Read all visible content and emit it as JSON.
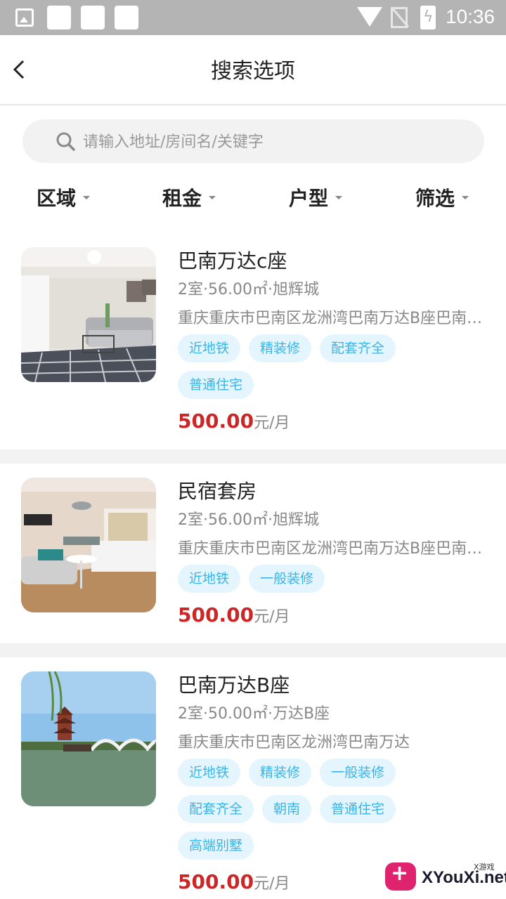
{
  "status_bar": {
    "time": "10:36"
  },
  "header": {
    "title": "搜索选项",
    "back_icon": "chevron-left-icon"
  },
  "search": {
    "placeholder": "请输入地址/房间名/关键字",
    "value": ""
  },
  "filters": [
    {
      "label": "区域"
    },
    {
      "label": "租金"
    },
    {
      "label": "户型"
    },
    {
      "label": "筛选"
    }
  ],
  "listings": [
    {
      "title": "巴南万达c座",
      "spec": "2室·56.00㎡·旭辉城",
      "address": "重庆重庆市巴南区龙洲湾巴南万达B座巴南万达",
      "tags": [
        "近地铁",
        "精装修",
        "配套齐全",
        "普通住宅"
      ],
      "price": "500.00",
      "unit": "元/月",
      "image": "living-room-photo"
    },
    {
      "title": "民宿套房",
      "spec": "2室·56.00㎡·旭辉城",
      "address": "重庆重庆市巴南区龙洲湾巴南万达B座巴南万达",
      "tags": [
        "近地铁",
        "一般装修"
      ],
      "price": "500.00",
      "unit": "元/月",
      "image": "bedroom-photo"
    },
    {
      "title": "巴南万达B座",
      "spec": "2室·50.00㎡·万达B座",
      "address": "重庆重庆市巴南区龙洲湾巴南万达",
      "tags": [
        "近地铁",
        "精装修",
        "一般装修",
        "配套齐全",
        "朝南",
        "普通住宅",
        "高端别墅"
      ],
      "price": "500.00",
      "unit": "元/月",
      "image": "pagoda-lake-photo"
    }
  ],
  "watermark": {
    "text": "XYouXi.net",
    "small": "X游戏"
  },
  "colors": {
    "price": "#cc2727",
    "tag_text": "#3ab4e6",
    "tag_bg": "#e5f5fd"
  }
}
